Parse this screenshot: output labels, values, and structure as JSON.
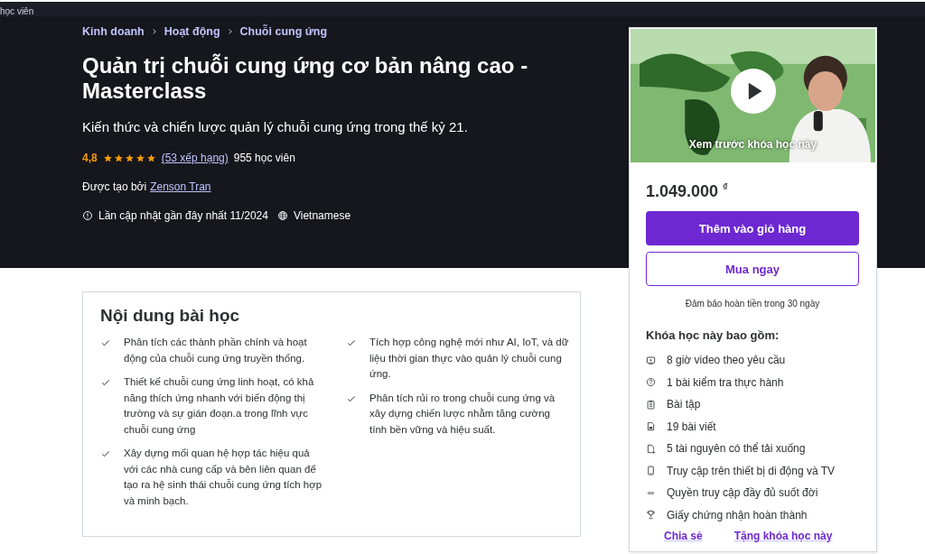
{
  "top_strip": {
    "text": "học viên"
  },
  "breadcrumb": [
    "Kinh doanh",
    "Hoạt động",
    "Chuỗi cung ứng"
  ],
  "title": "Quản trị chuỗi cung ứng cơ bản nâng cao - Masterclass",
  "subtitle": "Kiến thức và chiến lược quản lý chuỗi cung ứng trong thế kỷ 21.",
  "rating": {
    "score": "4,8",
    "stars": 5,
    "count": "(53 xếp hạng)",
    "students": "955 học viên"
  },
  "created_by": {
    "label": "Được tạo bởi",
    "author": "Zenson Tran"
  },
  "updated": {
    "text": "Lần cập nhật gần đây nhất 11/2024",
    "language": "Vietnamese"
  },
  "learn": {
    "title": "Nội dung bài học",
    "columns": [
      [
        "Phân tích các thành phần chính và hoạt động của chuỗi cung ứng truyền thống.",
        "Thiết kế chuỗi cung ứng linh hoạt, có khả năng thích ứng nhanh với biến động thị trường và sự gián đoạn.a trong lĩnh vực chuỗi cung ứng",
        "Xây dựng mối quan hệ hợp tác hiệu quả với các nhà cung cấp và bên liên quan để tạo ra hệ sinh thái chuỗi cung ứng tích hợp và minh bạch."
      ],
      [
        "Tích hợp công nghệ mới như AI, IoT, và dữ liệu thời gian thực vào quản lý chuỗi cung ứng.",
        "Phân tích rủi ro trong chuỗi cung ứng và xây dựng chiến lược nhằm tăng cường tính bền vững và hiệu suất."
      ]
    ]
  },
  "card": {
    "preview": {
      "kind": "picture",
      "label": "Xem trước khóa học này"
    },
    "price": "1.049.000",
    "currency": "₫",
    "buttons": [
      {
        "label": "Thêm vào giỏ hàng",
        "kind": "primary"
      },
      {
        "label": "Mua ngay",
        "kind": "outline"
      }
    ],
    "guarantee": "Đảm bảo hoàn tiền trong 30 ngày",
    "includes_title": "Khóa học này bao gồm:",
    "includes": [
      {
        "kind": "video",
        "text": "8 giờ video theo yêu cầu"
      },
      {
        "kind": "quiz",
        "text": "1 bài kiểm tra thực hành"
      },
      {
        "kind": "assignment",
        "text": "Bài tập"
      },
      {
        "kind": "article",
        "text": "19 bài viết"
      },
      {
        "kind": "download",
        "text": "5 tài nguyên có thể tải xuống"
      },
      {
        "kind": "mobile",
        "text": "Truy cập trên thiết bị di động và TV"
      },
      {
        "kind": "lifetime",
        "text": "Quyền truy cập đầy đủ suốt đời"
      },
      {
        "kind": "certificate",
        "text": "Giấy chứng nhận hoàn thành"
      }
    ],
    "links": [
      "Chia sẻ",
      "Tặng khóa học này"
    ]
  }
}
